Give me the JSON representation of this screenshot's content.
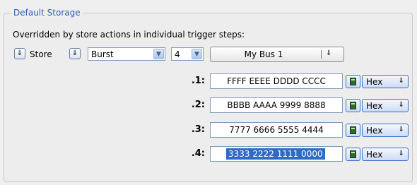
{
  "group": {
    "title": "Default Storage",
    "subtitle": "Overridden by store actions in individual trigger steps:"
  },
  "store_row": {
    "store_label": "Store",
    "mode_value": "Burst",
    "count_value": "4",
    "bus_label": "My Bus 1"
  },
  "rows": [
    {
      "label": ".1:",
      "value": "FFFF EEEE DDDD CCCC",
      "format": "Hex",
      "selected": false
    },
    {
      "label": ".2:",
      "value": "BBBB AAAA 9999 8888",
      "format": "Hex",
      "selected": false
    },
    {
      "label": ".3:",
      "value": "7777 6666 5555 4444",
      "format": "Hex",
      "selected": false
    },
    {
      "label": ".4:",
      "value": "3333 2222 1111 0000",
      "format": "Hex",
      "selected": true
    }
  ],
  "colors": {
    "legend": "#2f5fb4",
    "selection": "#3169c6"
  },
  "icons": {
    "toggle": "double-chevron-down-icon",
    "combo_arrow": "chevron-down-icon",
    "calculator": "calculator-icon"
  }
}
